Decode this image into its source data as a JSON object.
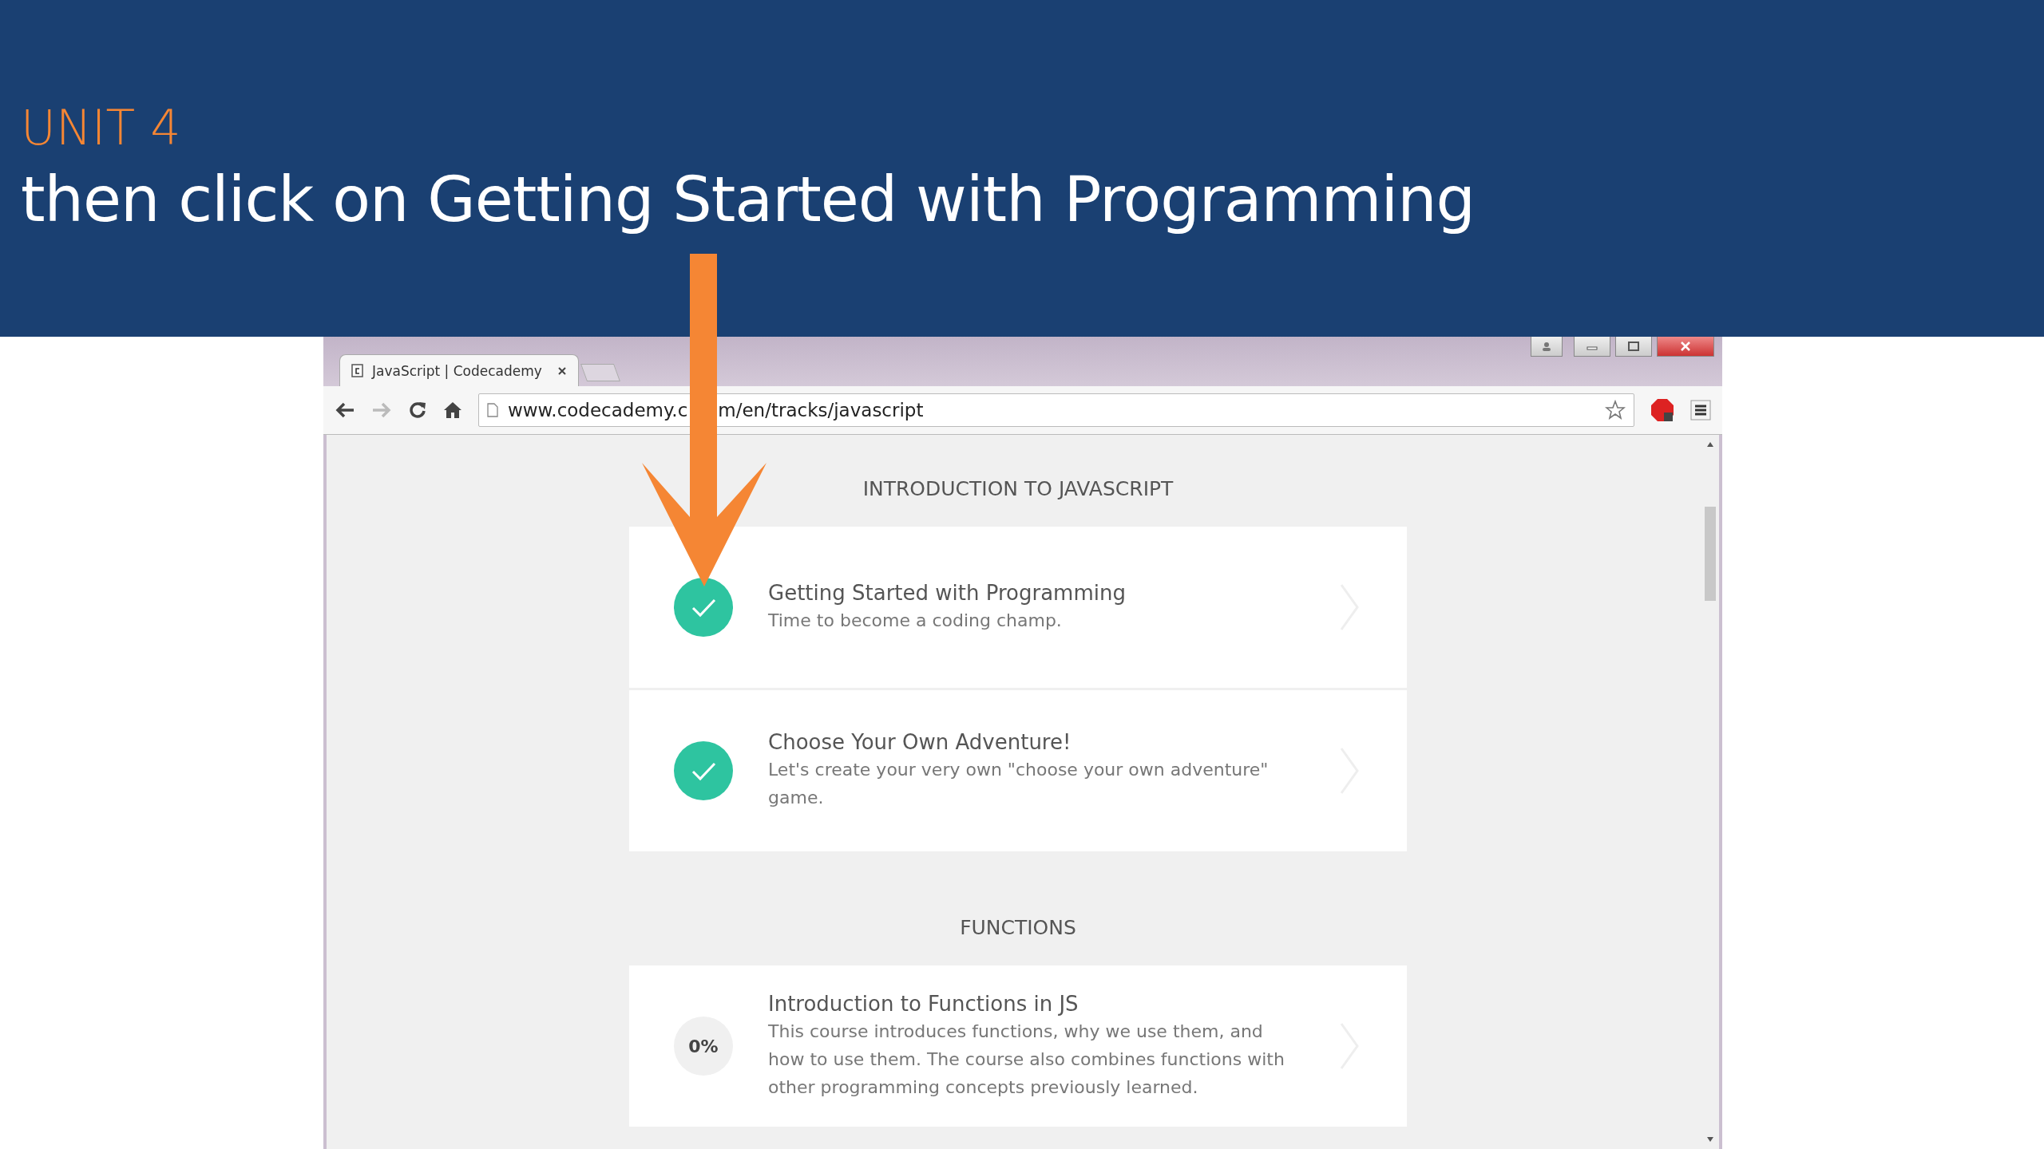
{
  "banner": {
    "unit": "UNIT 4",
    "title": "then click on Getting Started with Programming"
  },
  "browser": {
    "tab": {
      "title": "JavaScript | Codecademy",
      "selected": true
    },
    "url_start": "www.codecademy.c",
    "url_end": "m/en/tracks/javascript"
  },
  "sections": [
    {
      "title": "INTRODUCTION TO JAVASCRIPT",
      "courses": [
        {
          "kind": "completed",
          "title": "Getting Started with Programming",
          "description": "Time to become a coding champ."
        },
        {
          "kind": "completed",
          "title": "Choose Your Own Adventure!",
          "description": "Let's create your very own \"choose your own adventure\" game."
        }
      ]
    },
    {
      "title": "FUNCTIONS",
      "courses": [
        {
          "kind": "progress",
          "progress": "0%",
          "title": "Introduction to Functions in JS",
          "description": "This course introduces functions, why we use them, and how to use them. The course also combines functions with other programming concepts previously learned."
        }
      ]
    }
  ]
}
